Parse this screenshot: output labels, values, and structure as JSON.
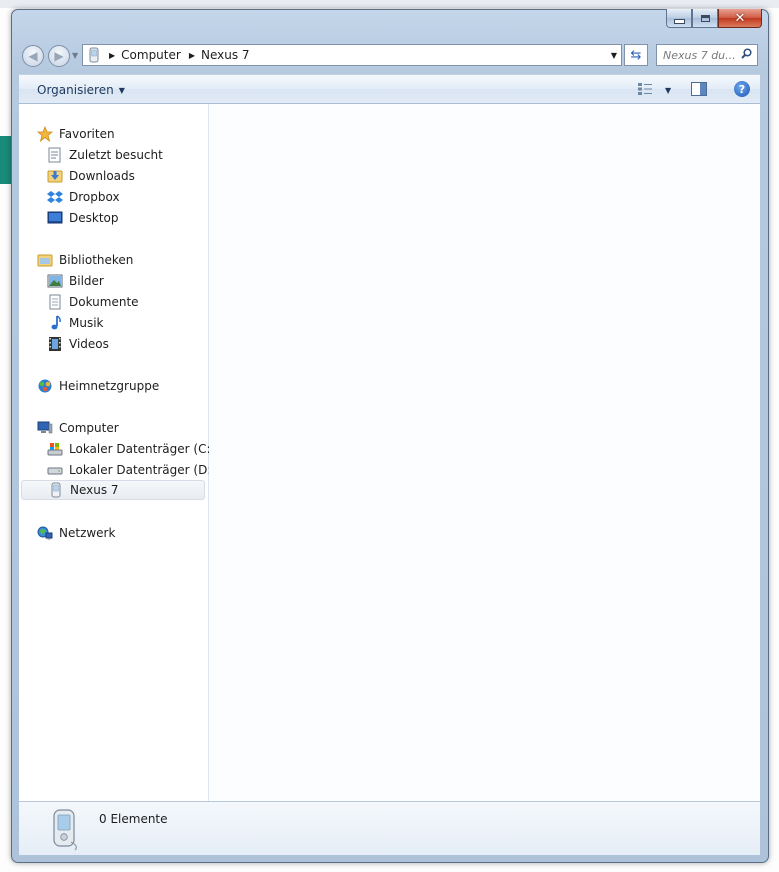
{
  "window": {
    "address": {
      "crumbs": [
        "Computer",
        "Nexus 7"
      ]
    },
    "search": {
      "placeholder": "Nexus 7 du..."
    },
    "toolbar": {
      "organize_label": "Organisieren"
    },
    "nav_pane": {
      "favorites": {
        "label": "Favoriten",
        "items": [
          {
            "label": "Zuletzt besucht",
            "icon": "recent-places-icon"
          },
          {
            "label": "Downloads",
            "icon": "downloads-folder-icon"
          },
          {
            "label": "Dropbox",
            "icon": "dropbox-icon"
          },
          {
            "label": "Desktop",
            "icon": "desktop-icon"
          }
        ]
      },
      "libraries": {
        "label": "Bibliotheken",
        "items": [
          {
            "label": "Bilder",
            "icon": "pictures-icon"
          },
          {
            "label": "Dokumente",
            "icon": "documents-icon"
          },
          {
            "label": "Musik",
            "icon": "music-icon"
          },
          {
            "label": "Videos",
            "icon": "videos-icon"
          }
        ]
      },
      "homegroup": {
        "label": "Heimnetzgruppe"
      },
      "computer": {
        "label": "Computer",
        "items": [
          {
            "label": "Lokaler Datenträger (C:)",
            "icon": "system-drive-icon"
          },
          {
            "label": "Lokaler Datenträger (D:)",
            "icon": "drive-icon"
          },
          {
            "label": "Nexus 7",
            "icon": "portable-device-icon",
            "selected": true
          }
        ]
      },
      "network": {
        "label": "Netzwerk"
      }
    },
    "details": {
      "status": "0 Elemente"
    }
  },
  "colors": {
    "frame": "#b5c9df",
    "selection": "#e9edf2",
    "link_blue": "#1e395b",
    "close_red": "#c0391f"
  }
}
